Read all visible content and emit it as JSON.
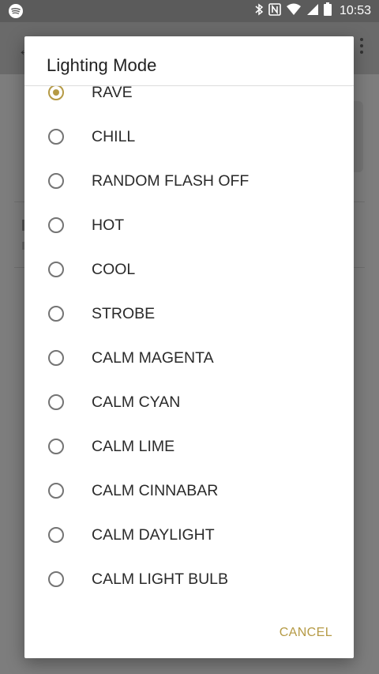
{
  "status_bar": {
    "time": "10:53",
    "icons": [
      "spotify-icon",
      "bluetooth-icon",
      "nfc-icon",
      "wifi-icon",
      "cell-signal-icon",
      "battery-icon"
    ]
  },
  "dialog": {
    "title": "Lighting Mode",
    "selected": "RAVE",
    "options": [
      "RAVE",
      "CHILL",
      "RANDOM FLASH OFF",
      "HOT",
      "COOL",
      "STROBE",
      "CALM MAGENTA",
      "CALM CYAN",
      "CALM LIME",
      "CALM CINNABAR",
      "CALM DAYLIGHT",
      "CALM LIGHT BULB"
    ],
    "cancel_label": "CANCEL"
  },
  "colors": {
    "accent": "#b59a45",
    "scrim": "#7c7c7c",
    "text_primary": "#212121"
  }
}
